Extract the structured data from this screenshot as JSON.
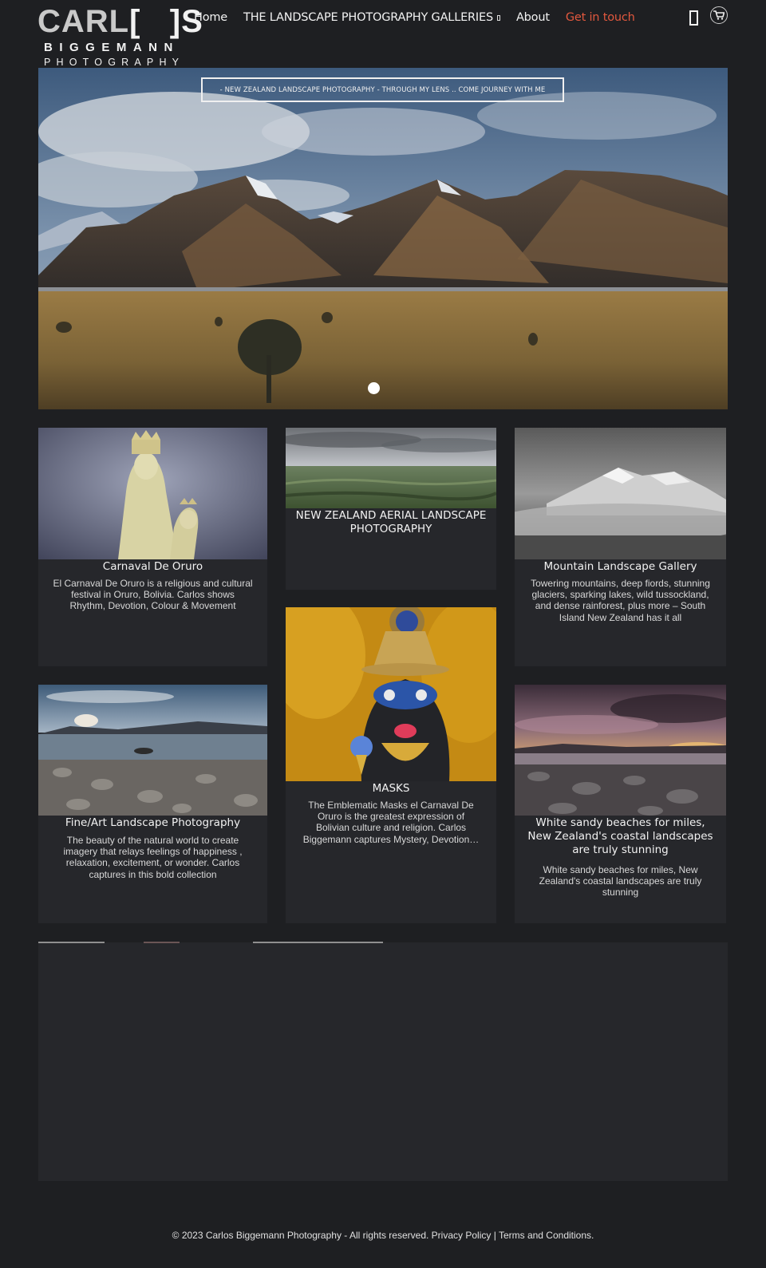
{
  "logo": {
    "line1_a": "CARL",
    "line1_b": "[",
    "line1_c": "]S",
    "line2": "BIGGEMANN",
    "line3": "PHOTOGRAPHY"
  },
  "nav": {
    "items": [
      {
        "label": "Home"
      },
      {
        "label": "THE LANDSCAPE PHOTOGRAPHY GALLERIES"
      },
      {
        "label": "About"
      },
      {
        "label": "Get in touch"
      }
    ],
    "accent_color": "#e2583e"
  },
  "header_icons": {
    "phone": "phone-icon",
    "cart": "cart-icon"
  },
  "hero": {
    "caption": "- NEW ZEALAND LANDSCAPE PHOTOGRAPHY - THROUGH MY LENS .. COME JOURNEY WITH ME",
    "slides_count": 1,
    "active_slide": 1
  },
  "cards": [
    {
      "title": "Carnaval De Oruro",
      "desc": "El Carnaval De Oruro is a religious and cultural festival in Oruro, Bolivia. Carlos shows Rhythm, Devotion, Colour & Movement"
    },
    {
      "title": "NEW ZEALAND AERIAL LANDSCAPE PHOTOGRAPHY",
      "desc": ""
    },
    {
      "title": "Mountain Landscape Gallery",
      "desc": "Towering mountains, deep fiords, stunning glaciers, sparking lakes, wild tussockland, and dense rainforest, plus more – South Island New Zealand has it all"
    },
    {
      "title": "Fine/Art Landscape Photography",
      "desc": "The beauty of the natural world to create imagery that relays feelings of happiness , relaxation, excitement, or wonder. Carlos captures in this bold collection"
    },
    {
      "title": "MASKS",
      "desc": "The Emblematic Masks el Carnaval De Oruro is the greatest expression of Bolivian culture and religion. Carlos Biggemann captures Mystery, Devotion…"
    },
    {
      "title": "White sandy beaches for miles, New Zealand's coastal landscapes are truly stunning",
      "desc": "White sandy beaches for miles, New Zealand's coastal landscapes are truly stunning"
    }
  ],
  "footer": {
    "copyright": "© 2023 Carlos Biggemann Photography - All rights reserved.",
    "privacy": "Privacy Policy",
    "separator": "|",
    "terms": "Terms and Conditions."
  }
}
